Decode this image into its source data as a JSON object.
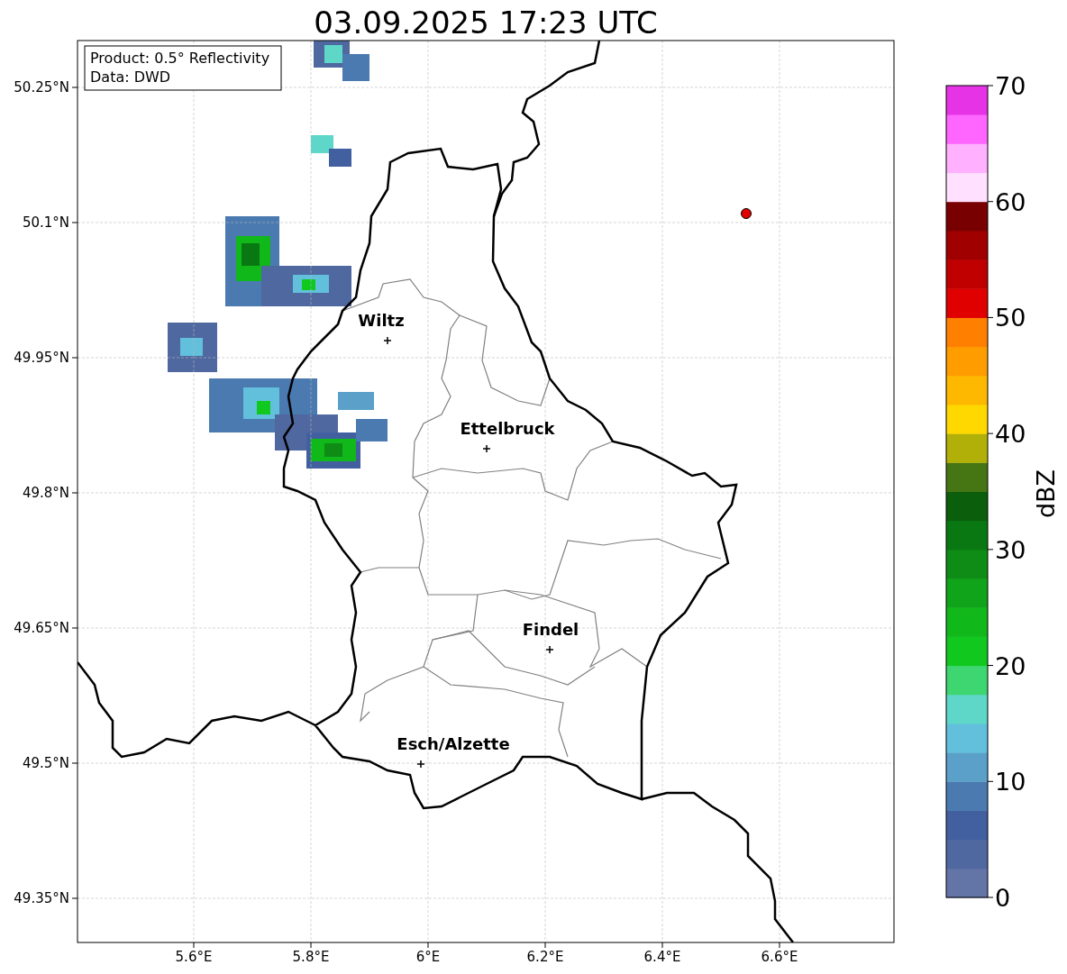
{
  "title": "03.09.2025 17:23 UTC",
  "info_box": {
    "lines": [
      "Product: 0.5° Reflectivity",
      "Data: DWD"
    ]
  },
  "map": {
    "lat_ticks": [
      "50.25°N",
      "50.1°N",
      "49.95°N",
      "49.8°N",
      "49.65°N",
      "49.5°N",
      "49.35°N"
    ],
    "lon_ticks": [
      "5.6°E",
      "5.8°E",
      "6°E",
      "6.2°E",
      "6.4°E",
      "6.6°E"
    ],
    "cities": [
      {
        "name": "Wiltz"
      },
      {
        "name": "Ettelbruck"
      },
      {
        "name": "Findel"
      },
      {
        "name": "Esch/Alzette"
      }
    ]
  },
  "colorbar": {
    "label": "dBZ",
    "ticks": [
      "70",
      "60",
      "50",
      "40",
      "30",
      "20",
      "10",
      "0"
    ],
    "segments": [
      {
        "color": "#6374a6"
      },
      {
        "color": "#5068a0"
      },
      {
        "color": "#4260a0"
      },
      {
        "color": "#4a7ab0"
      },
      {
        "color": "#5aa0c8"
      },
      {
        "color": "#62c0dc"
      },
      {
        "color": "#5ed6c8"
      },
      {
        "color": "#3ed670"
      },
      {
        "color": "#10c81e"
      },
      {
        "color": "#10b81a"
      },
      {
        "color": "#10a41a"
      },
      {
        "color": "#0e8c16"
      },
      {
        "color": "#0a7812"
      },
      {
        "color": "#0a5e0c"
      },
      {
        "color": "#467614"
      },
      {
        "color": "#b0b008"
      },
      {
        "color": "#ffd800"
      },
      {
        "color": "#ffb800"
      },
      {
        "color": "#ff9c00"
      },
      {
        "color": "#ff8000"
      },
      {
        "color": "#e00000"
      },
      {
        "color": "#c00000"
      },
      {
        "color": "#a00000"
      },
      {
        "color": "#780000"
      },
      {
        "color": "#ffe0ff"
      },
      {
        "color": "#ffb0ff"
      },
      {
        "color": "#ff66ff"
      },
      {
        "color": "#e633e6"
      }
    ]
  }
}
